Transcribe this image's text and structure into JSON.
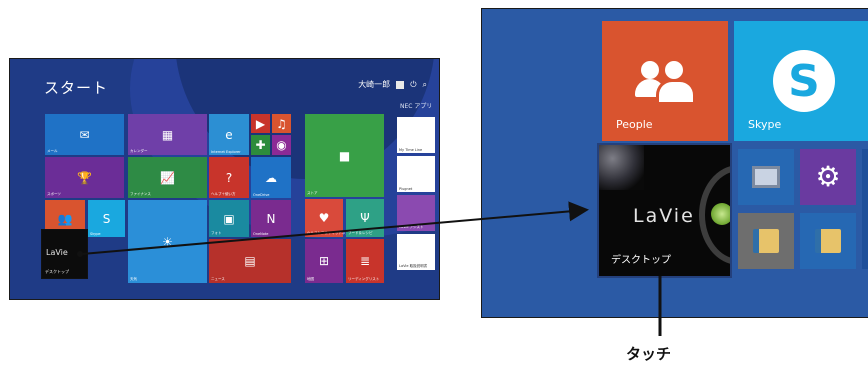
{
  "small_screen": {
    "title": "スタート",
    "user_name": "大崎一郎",
    "group_label": "NEC アプリ",
    "tiles": [
      {
        "id": "mail",
        "label": "メール",
        "color": "#1f72c6",
        "icon": "envelope-icon",
        "glyph": "✉"
      },
      {
        "id": "calendar",
        "label": "カレンダー",
        "color": "#6f3fa8",
        "icon": "calendar-icon",
        "glyph": "▦"
      },
      {
        "id": "ie",
        "label": "Internet Explorer",
        "color": "#2c8fd3",
        "icon": "ie-icon",
        "glyph": "e"
      },
      {
        "id": "video",
        "label": "",
        "color": "#c8342b",
        "icon": "video-icon",
        "glyph": "▶"
      },
      {
        "id": "music",
        "label": "",
        "color": "#d9542f",
        "icon": "headphones-icon",
        "glyph": "♫"
      },
      {
        "id": "games",
        "label": "",
        "color": "#2d8c3c",
        "icon": "gamepad-icon",
        "glyph": "✚"
      },
      {
        "id": "camera",
        "label": "",
        "color": "#8c2a96",
        "icon": "camera-icon",
        "glyph": "◉"
      },
      {
        "id": "store",
        "label": "ストア",
        "color": "#38a047",
        "icon": "store-icon",
        "glyph": "■"
      },
      {
        "id": "sports",
        "label": "スポーツ",
        "color": "#6b2d97",
        "icon": "trophy-icon",
        "glyph": "🏆"
      },
      {
        "id": "finance",
        "label": "ファイナンス",
        "color": "#2e8b45",
        "icon": "chart-icon",
        "glyph": "📈"
      },
      {
        "id": "help",
        "label": "ヘルプ＋使い方",
        "color": "#c8342b",
        "icon": "question-icon",
        "glyph": "?"
      },
      {
        "id": "onedrive",
        "label": "OneDrive",
        "color": "#1f72c6",
        "icon": "cloud-icon",
        "glyph": "☁"
      },
      {
        "id": "health",
        "label": "ヘルスケア＆フィットネス",
        "color": "#d94a3b",
        "icon": "heart-icon",
        "glyph": "♥"
      },
      {
        "id": "food",
        "label": "フード＆レシピ",
        "color": "#2ea186",
        "icon": "food-icon",
        "glyph": "Ψ"
      },
      {
        "id": "people",
        "label": "",
        "color": "#d9542f",
        "icon": "people-icon",
        "glyph": "👥"
      },
      {
        "id": "skype",
        "label": "Skype",
        "color": "#1aa8df",
        "icon": "skype-icon",
        "glyph": "S"
      },
      {
        "id": "weather",
        "label": "天気",
        "color": "#2b8fd8",
        "icon": "sun-icon",
        "glyph": "☀"
      },
      {
        "id": "photos",
        "label": "フォト",
        "color": "#1a8aa0",
        "icon": "photo-icon",
        "glyph": "▣"
      },
      {
        "id": "onenote",
        "label": "OneNote",
        "color": "#7a2b8f",
        "icon": "onenote-icon",
        "glyph": "N"
      },
      {
        "id": "news",
        "label": "ニュース",
        "color": "#b6312b",
        "icon": "news-icon",
        "glyph": "▤"
      },
      {
        "id": "maps",
        "label": "地図",
        "color": "#7a2b8f",
        "icon": "map-icon",
        "glyph": "⊞"
      },
      {
        "id": "reading",
        "label": "リーディングリスト",
        "color": "#c8342b",
        "icon": "list-icon",
        "glyph": "≣"
      },
      {
        "id": "my-time-line",
        "label": "My Time Line",
        "color": "#ffffff",
        "icon": "timeline-icon",
        "glyph": ""
      },
      {
        "id": "plugnet",
        "label": "Plugnet",
        "color": "#ffffff",
        "icon": "plugnet-icon",
        "glyph": ""
      },
      {
        "id": "lavie-assist",
        "label": "LaVie アシスト",
        "color": "#8b4ab0",
        "icon": "assist-icon",
        "glyph": ""
      },
      {
        "id": "lavie-handbook",
        "label": "LaVie 取扱説明書",
        "color": "#ffffff",
        "icon": "book-icon",
        "glyph": ""
      }
    ],
    "desktop_tile": {
      "brand": "LaVie",
      "label": "デスクトップ"
    }
  },
  "zoom_screen": {
    "people_label": "People",
    "skype_label": "Skype",
    "skype_glyph": "S",
    "desktop_brand": "LaVie",
    "desktop_label": "デスクトップ",
    "gear_glyph": "⚙",
    "colors": {
      "background": "#2b5aa5",
      "people": "#d9542f",
      "skype": "#1aa8df"
    }
  },
  "annotation": {
    "touch_label": "タッチ"
  }
}
